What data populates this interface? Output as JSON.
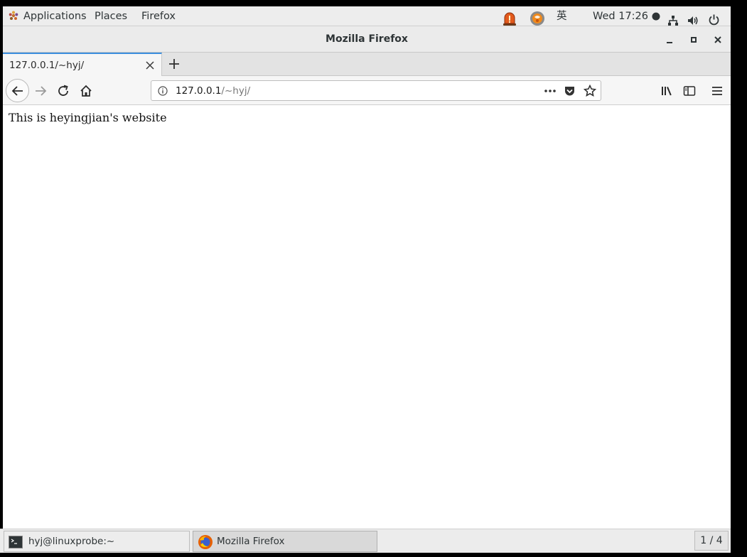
{
  "top_panel": {
    "applications": "Applications",
    "places": "Places",
    "firefox": "Firefox",
    "input_method": "英",
    "clock": "Wed 17:26 ●",
    "icons": [
      "alarm-icon",
      "orange-app-icon",
      "network-icon",
      "volume-icon",
      "power-icon"
    ]
  },
  "window": {
    "title": "Mozilla Firefox",
    "controls": [
      "minimize",
      "maximize",
      "close"
    ]
  },
  "tabs": [
    {
      "title": "127.0.0.1/~hyj/",
      "active": true
    }
  ],
  "urlbar": {
    "host": "127.0.0.1",
    "path": "/~hyj/"
  },
  "page": {
    "text": "This is heyingjian's website"
  },
  "taskbar": {
    "items": [
      {
        "label": "hyj@linuxprobe:~",
        "icon": "terminal-icon"
      },
      {
        "label": "Mozilla Firefox",
        "icon": "firefox-icon",
        "active": true
      }
    ],
    "workspace": "1 / 4"
  },
  "colors": {
    "tab_accent": "#3c8fde",
    "panel_bg": "#ededed",
    "content_bg": "#ffffff"
  }
}
